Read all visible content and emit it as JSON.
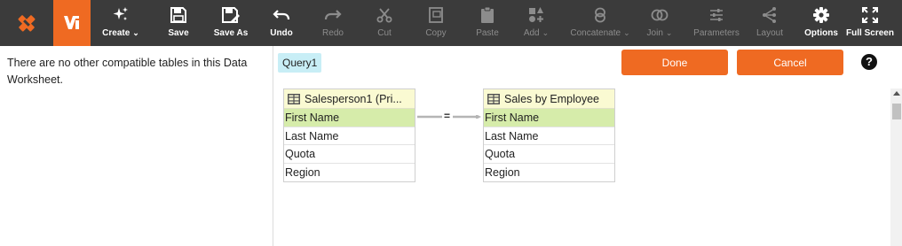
{
  "toolbar": {
    "buttons": [
      {
        "label": "Create",
        "has_caret": true,
        "enabled": true,
        "icon": "sparkle-icon"
      },
      {
        "label": "Save",
        "enabled": true,
        "icon": "save-icon"
      },
      {
        "label": "Save As",
        "enabled": true,
        "icon": "save-as-icon"
      },
      {
        "label": "Undo",
        "enabled": true,
        "icon": "undo-icon"
      },
      {
        "label": "Redo",
        "enabled": false,
        "icon": "redo-icon"
      },
      {
        "label": "Cut",
        "enabled": false,
        "icon": "scissors-icon"
      },
      {
        "label": "Copy",
        "enabled": false,
        "icon": "copy-icon"
      },
      {
        "label": "Paste",
        "enabled": false,
        "icon": "clipboard-icon"
      },
      {
        "label": "Add",
        "has_caret": true,
        "enabled": false,
        "icon": "add-shapes-icon"
      },
      {
        "label": "Concatenate",
        "has_caret": true,
        "enabled": false,
        "icon": "concatenate-icon"
      },
      {
        "label": "Join",
        "has_caret": true,
        "enabled": false,
        "icon": "join-icon"
      },
      {
        "label": "Parameters",
        "enabled": false,
        "icon": "sliders-icon"
      },
      {
        "label": "Layout",
        "enabled": false,
        "icon": "layout-icon"
      },
      {
        "label": "Options",
        "enabled": true,
        "icon": "gear-icon"
      },
      {
        "label": "Full Screen",
        "enabled": true,
        "icon": "fullscreen-icon"
      }
    ],
    "caret": "⌄"
  },
  "left_panel": {
    "message": "There are no other compatible tables in this Data Worksheet."
  },
  "query": {
    "tab_label": "Query1",
    "done_label": "Done",
    "cancel_label": "Cancel",
    "help_label": "?"
  },
  "tables": [
    {
      "title": "Salesperson1 (Pri...",
      "columns": [
        "First Name",
        "Last Name",
        "Quota",
        "Region"
      ],
      "selected": "First Name"
    },
    {
      "title": "Sales by Employee",
      "columns": [
        "First Name",
        "Last Name",
        "Quota",
        "Region"
      ],
      "selected": "First Name"
    }
  ],
  "join": {
    "operator": "="
  },
  "colors": {
    "accent": "#ef6a22",
    "toolbar": "#3b3b3b",
    "selected_row": "#d6ecaa",
    "table_header": "#fafad2",
    "query_tab": "#c8eef6"
  }
}
